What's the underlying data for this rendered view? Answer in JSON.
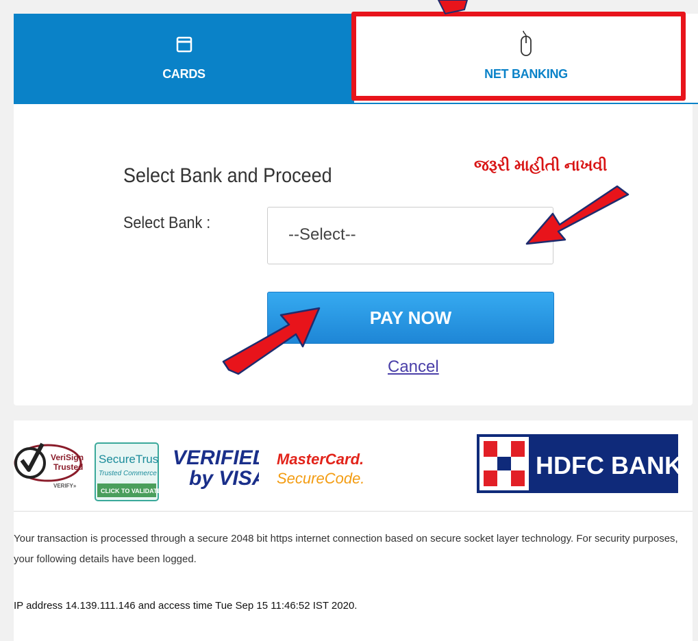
{
  "tabs": [
    {
      "label": "CARDS",
      "icon": "card-icon"
    },
    {
      "label": "NET BANKING",
      "icon": "mouse-icon"
    }
  ],
  "annotation": {
    "text": "જરૂરી માહીતી નાખવી"
  },
  "form": {
    "title": "Select Bank and Proceed",
    "bank_label": "Select Bank :",
    "bank_select_value": "--Select--",
    "pay_button": "PAY NOW",
    "cancel_link": "Cancel"
  },
  "logos": {
    "verisign_line1": "VeriSign",
    "verisign_line2": "Trusted",
    "verisign_sub": "VERIFY»",
    "securetrust_title": "SecureTrust",
    "securetrust_sub": "Trusted Commerce",
    "securetrust_cta": "CLICK TO VALIDATE",
    "visa_line1": "VERIFIED",
    "visa_line2": "by VISA",
    "mc_line1": "MasterCard.",
    "mc_line2": "SecureCode.",
    "bank_name": "HDFC BANK"
  },
  "footer": {
    "secure_text": "Your transaction is processed through a secure 2048 bit https internet connection based on secure socket layer technology. For security purposes, your following details have been logged.",
    "ip_text": "IP address 14.139.111.146 and access time Tue Sep 15 11:46:52 IST 2020."
  },
  "colors": {
    "tab_blue": "#0a82c8",
    "highlight_red": "#e8141b",
    "pay_blue": "#2a98e6",
    "annotation_red": "#d81414"
  }
}
